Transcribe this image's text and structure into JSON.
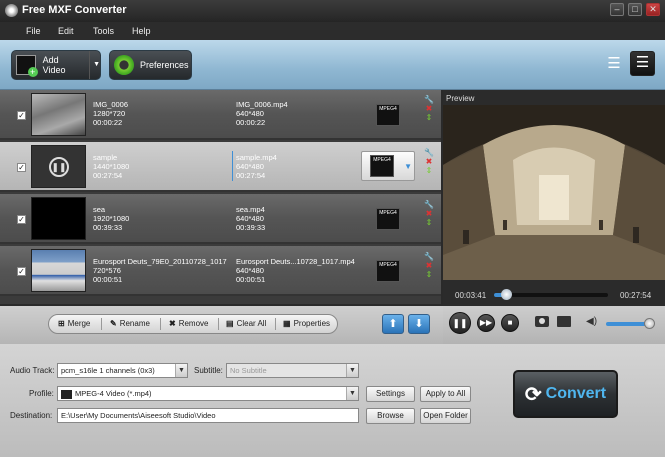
{
  "window": {
    "title": "Free MXF Converter"
  },
  "menu": [
    "File",
    "Edit",
    "Tools",
    "Help"
  ],
  "toolbar": {
    "add_video": "Add Video",
    "preferences": "Preferences"
  },
  "files": [
    {
      "name": "IMG_0006",
      "resolution": "1280*720",
      "duration": "00:00:22",
      "output_name": "IMG_0006.mp4",
      "output_resolution": "640*480",
      "output_duration": "00:00:22",
      "format_badge": "MPEG4",
      "checked": true,
      "selected": false
    },
    {
      "name": "sample",
      "resolution": "1440*1080",
      "duration": "00:27:54",
      "output_name": "sample.mp4",
      "output_resolution": "640*480",
      "output_duration": "00:27:54",
      "format_badge": "MPEG4",
      "checked": true,
      "selected": true
    },
    {
      "name": "sea",
      "resolution": "1920*1080",
      "duration": "00:39:33",
      "output_name": "sea.mp4",
      "output_resolution": "640*480",
      "output_duration": "00:39:33",
      "format_badge": "MPEG4",
      "checked": true,
      "selected": false
    },
    {
      "name": "Eurosport Deuts_79E0_20110728_1017",
      "resolution": "720*576",
      "duration": "00:00:51",
      "output_name": "Eurosport Deuts...10728_1017.mp4",
      "output_resolution": "640*480",
      "output_duration": "00:00:51",
      "format_badge": "MPEG4",
      "checked": true,
      "selected": false
    }
  ],
  "preview": {
    "label": "Preview",
    "time_current": "00:03:41",
    "time_total": "00:27:54",
    "progress": 0.11,
    "volume": 0.85
  },
  "actions": {
    "merge": "Merge",
    "rename": "Rename",
    "remove": "Remove",
    "clear_all": "Clear All",
    "properties": "Properties"
  },
  "settings": {
    "audio_track_label": "Audio Track:",
    "audio_track_value": "pcm_s16le 1 channels (0x3)",
    "subtitle_label": "Subtitle:",
    "subtitle_value": "No Subtitle",
    "profile_label": "Profile:",
    "profile_value": "MPEG-4 Video (*.mp4)",
    "settings_btn": "Settings",
    "apply_all_btn": "Apply to All",
    "destination_label": "Destination:",
    "destination_value": "E:\\User\\My Documents\\Aiseesoft Studio\\Video",
    "browse_btn": "Browse",
    "open_folder_btn": "Open Folder"
  },
  "convert": "Convert",
  "colors": {
    "accent": "#3e8fd6",
    "convert_text": "#4fb6ef",
    "toolbar": "#9cc0da"
  }
}
